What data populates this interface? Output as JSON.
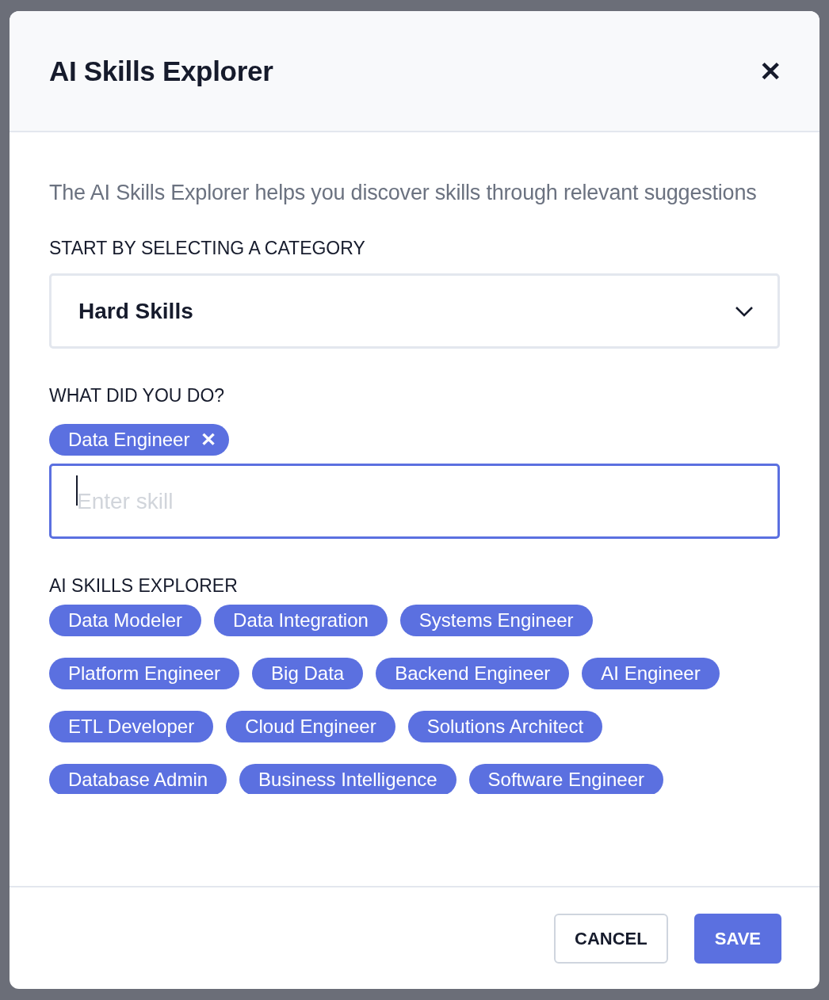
{
  "dialog": {
    "title": "AI Skills Explorer",
    "close_icon": "✕"
  },
  "description": "The AI Skills Explorer helps you discover skills through relevant suggestions",
  "category": {
    "label": "START BY SELECTING A CATEGORY",
    "value": "Hard Skills"
  },
  "activity": {
    "label": "WHAT DID YOU DO?",
    "tags": [
      {
        "label": "Data Engineer"
      }
    ],
    "input": {
      "placeholder": "Enter skill",
      "focused": true
    }
  },
  "suggestions": {
    "label": "AI SKILLS EXPLORER",
    "items": [
      {
        "label": "Data Modeler"
      },
      {
        "label": "Data Integration"
      },
      {
        "label": "Systems Engineer"
      },
      {
        "label": "Platform Engineer"
      },
      {
        "label": "Big Data"
      },
      {
        "label": "Backend Engineer"
      },
      {
        "label": "AI Engineer"
      },
      {
        "label": "ETL Developer"
      },
      {
        "label": "Cloud Engineer"
      },
      {
        "label": "Solutions Architect"
      },
      {
        "label": "Database Admin"
      },
      {
        "label": "Business Intelligence"
      },
      {
        "label": "Software Engineer"
      }
    ]
  },
  "buttons": [
    {
      "label": "CANCEL",
      "kind": "secondary"
    },
    {
      "label": "SAVE",
      "kind": "primary"
    }
  ]
}
